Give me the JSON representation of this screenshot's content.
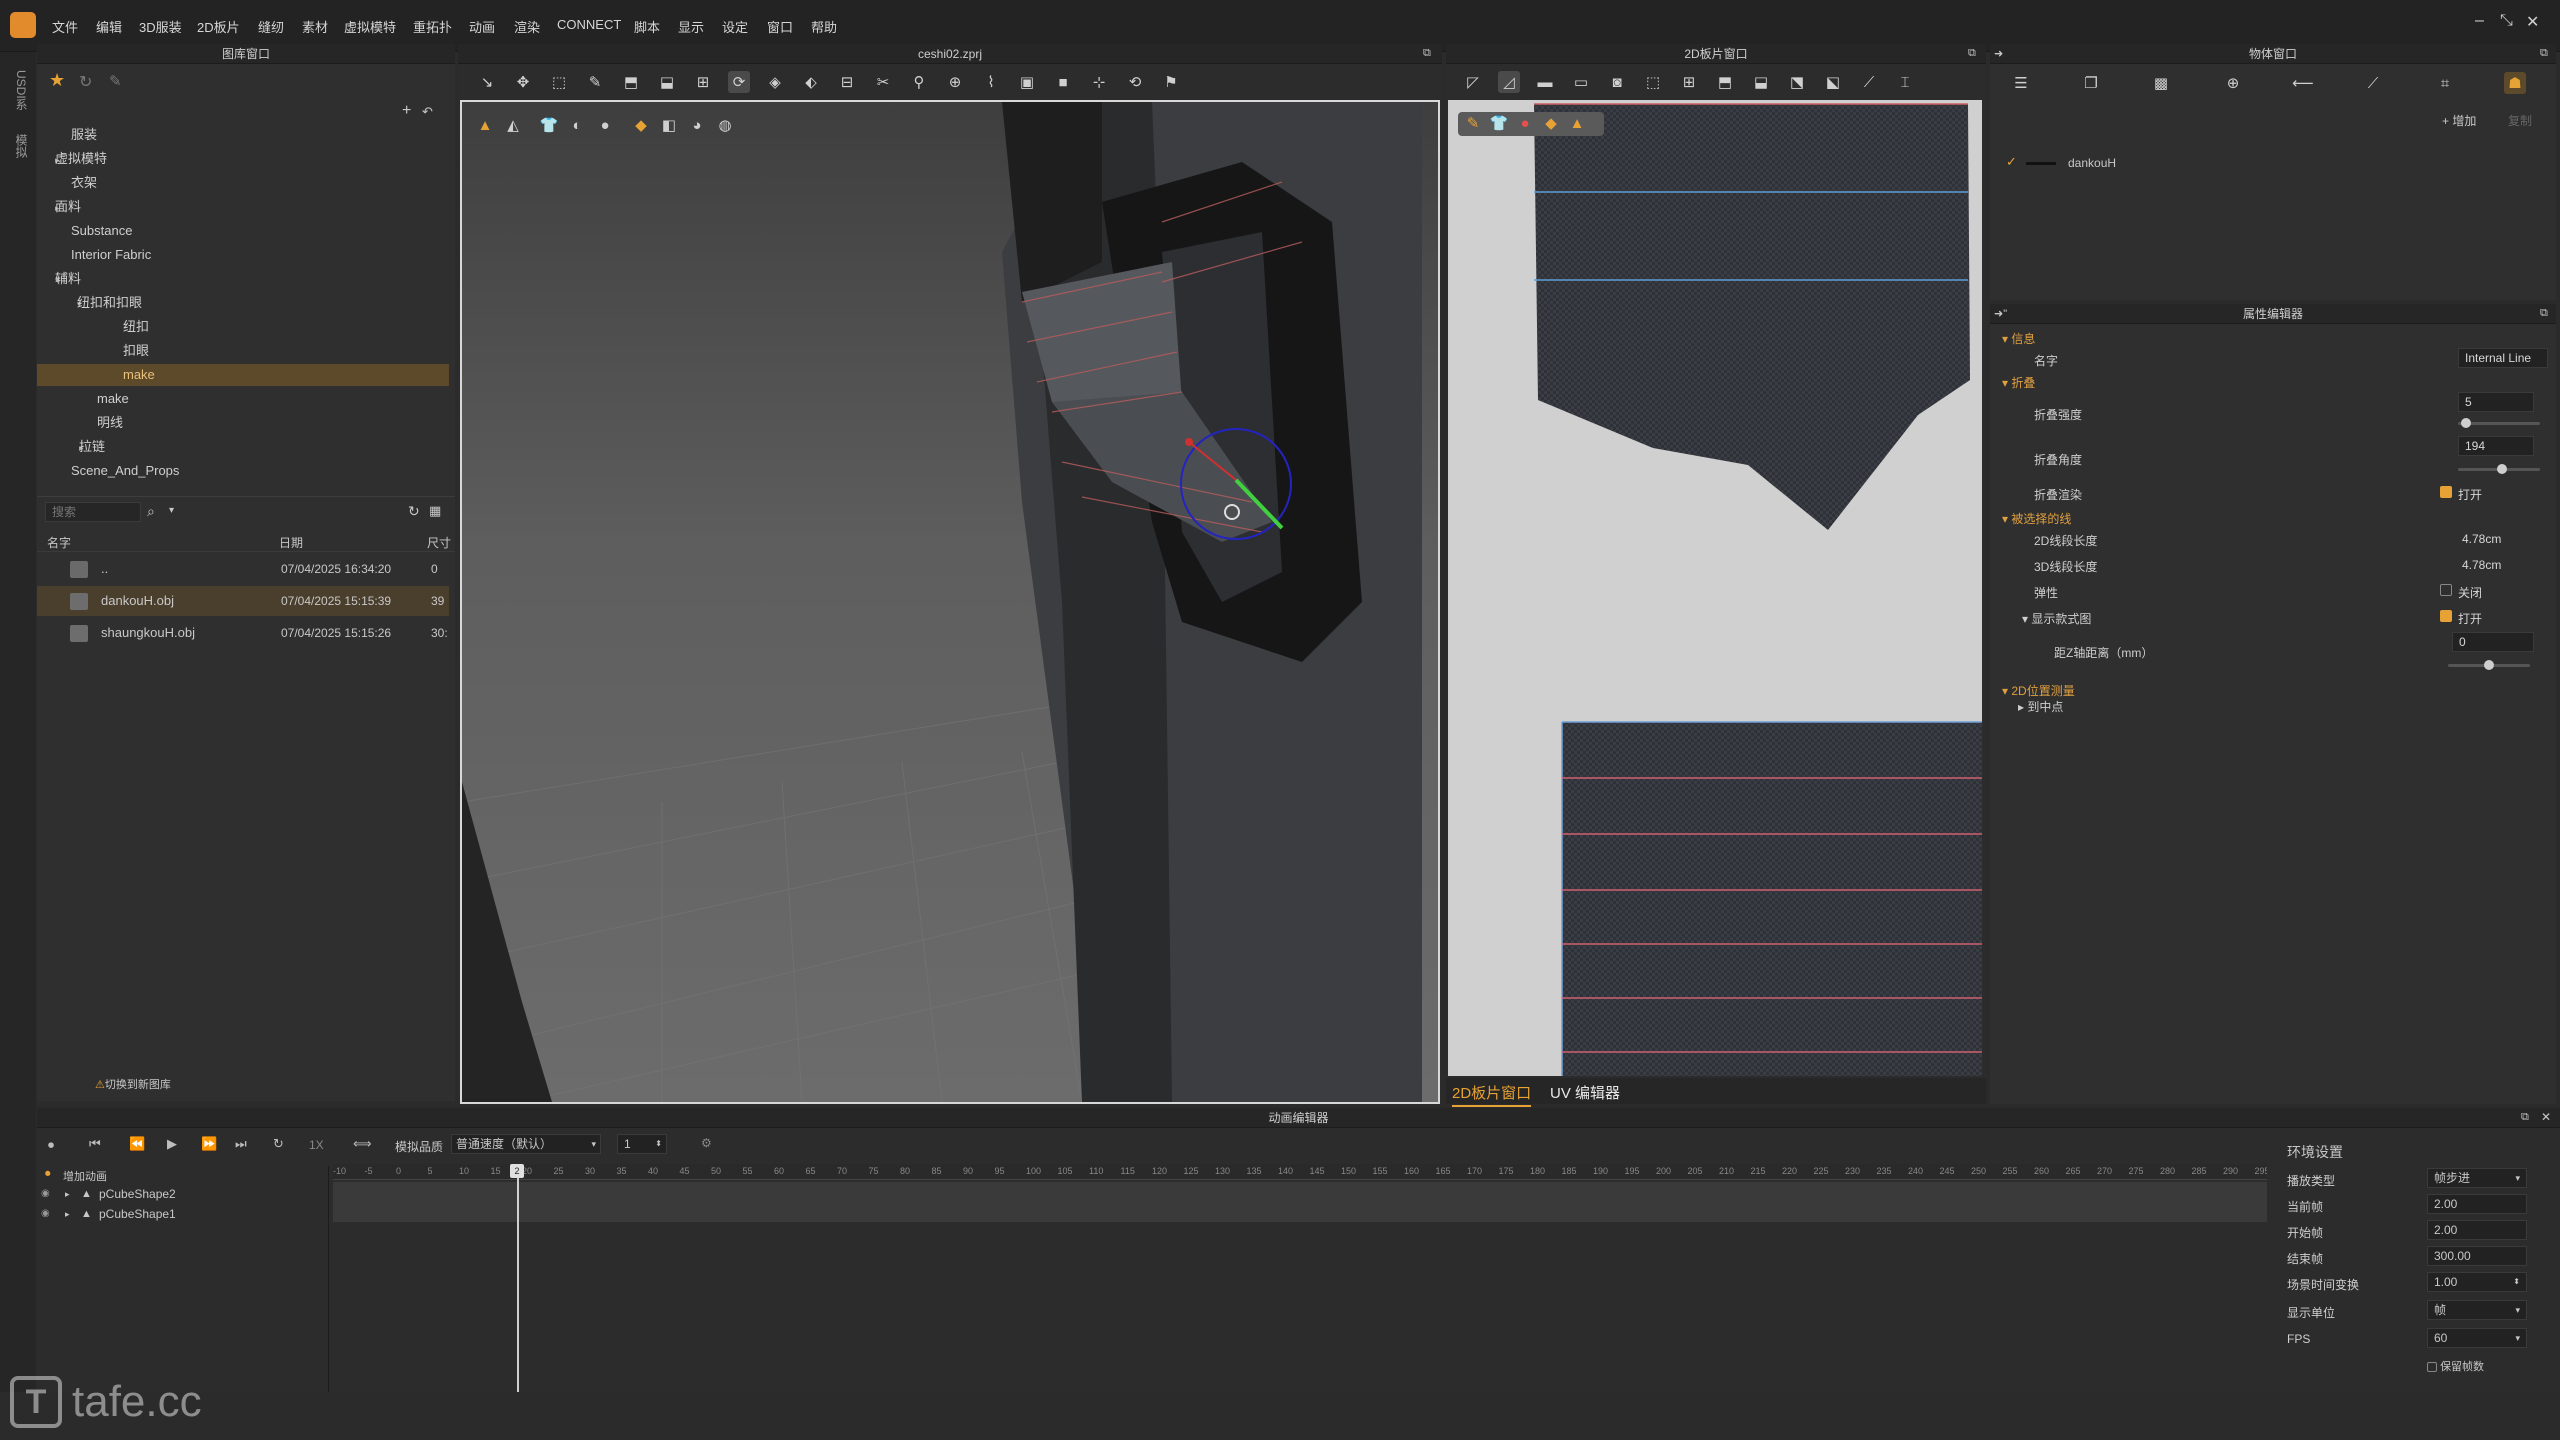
{
  "menubar": {
    "items": [
      "文件",
      "编辑",
      "3D服装",
      "2D板片",
      "缝纫",
      "素材",
      "虚拟模特",
      "重拓扑",
      "动画",
      "渲染",
      "CONNECT",
      "脚本",
      "显示",
      "设定",
      "窗口",
      "帮助"
    ]
  },
  "side_tabs": [
    "USDI系",
    "模拟"
  ],
  "library": {
    "title": "图库窗口",
    "tree": [
      {
        "label": "服装",
        "indent": 0,
        "arrow": ""
      },
      {
        "label": "虚拟模特",
        "indent": 0,
        "arrow": "▸"
      },
      {
        "label": "衣架",
        "indent": 0,
        "arrow": ""
      },
      {
        "label": "面料",
        "indent": 0,
        "arrow": "▸"
      },
      {
        "label": "Substance",
        "indent": 0,
        "arrow": ""
      },
      {
        "label": "Interior Fabric",
        "indent": 0,
        "arrow": ""
      },
      {
        "label": "辅料",
        "indent": 0,
        "arrow": "▾"
      },
      {
        "label": "纽扣和扣眼",
        "indent": 1,
        "arrow": "▾"
      },
      {
        "label": "纽扣",
        "indent": 2,
        "arrow": ""
      },
      {
        "label": "扣眼",
        "indent": 2,
        "arrow": ""
      },
      {
        "label": "make",
        "indent": 2,
        "arrow": "",
        "selected": true
      },
      {
        "label": "make",
        "indent": 1,
        "arrow": ""
      },
      {
        "label": "明线",
        "indent": 1,
        "arrow": ""
      },
      {
        "label": "拉链",
        "indent": 1,
        "arrow": "▸"
      },
      {
        "label": "Scene_And_Props",
        "indent": 0,
        "arrow": ""
      }
    ],
    "search_placeholder": "搜索",
    "columns": {
      "name": "名字",
      "date": "日期",
      "size": "尺寸"
    },
    "files": [
      {
        "name": "..",
        "date": "07/04/2025 16:34:20",
        "size": "0",
        "folder": true
      },
      {
        "name": "dankouH.obj",
        "date": "07/04/2025 15:15:39",
        "size": "39",
        "selected": true
      },
      {
        "name": "shaungkouH.obj",
        "date": "07/04/2025 15:15:26",
        "size": "30:"
      }
    ],
    "footer_link": "切换到新图库"
  },
  "viewport3d": {
    "title": "ceshi02.zprj"
  },
  "viewport2d": {
    "title": "2D板片窗口",
    "tabs": [
      "2D板片窗口",
      "UV 编辑器"
    ]
  },
  "object_window": {
    "title": "物体窗口",
    "add_label": "+ 增加",
    "copy_label": "复制",
    "items": [
      {
        "name": "dankouH",
        "checked": true
      }
    ]
  },
  "property_editor": {
    "title": "属性编辑器",
    "section_info": "信息",
    "name_label": "名字",
    "name_value": "Internal Line",
    "section_fold": "折叠",
    "fold_strength_label": "折叠强度",
    "fold_strength_value": "5",
    "fold_strength_fraction": 0.1,
    "fold_angle_label": "折叠角度",
    "fold_angle_value": "194",
    "fold_angle_fraction": 0.54,
    "fold_render_label": "折叠渲染",
    "fold_render_value": "打开",
    "section_selected_line": "被选择的线",
    "len2d_label": "2D线段长度",
    "len2d_value": "4.78cm",
    "len3d_label": "3D线段长度",
    "len3d_value": "4.78cm",
    "elastic_label": "弹性",
    "elastic_value": "关闭",
    "show_style_label": "显示款式图",
    "show_style_value": "打开",
    "z_offset_label": "距Z轴距离（mm）",
    "z_offset_value": "0",
    "z_offset_fraction": 0.5,
    "section_2d_measure": "2D位置测量",
    "to_midpoint": "到中点"
  },
  "anim_editor": {
    "title": "动画编辑器",
    "sim_quality_label": "模拟品质",
    "speed_value": "普通速度（默认）",
    "step_value": "1",
    "speed_x": "1X",
    "add_anim": "增加动画",
    "tracks": [
      "pCubeShape2",
      "pCubeShape1"
    ],
    "current_frame_marker": "2",
    "ruler_labels": [
      "-10",
      "-5",
      "0",
      "5",
      "10",
      "15",
      "20",
      "25",
      "30",
      "35",
      "40",
      "45",
      "50",
      "55",
      "60",
      "65",
      "70",
      "75",
      "80",
      "85",
      "90",
      "95",
      "100",
      "105",
      "110",
      "115",
      "120",
      "125",
      "130",
      "135",
      "140",
      "145",
      "150",
      "155",
      "160",
      "165",
      "170",
      "175",
      "180",
      "185",
      "190",
      "195",
      "200",
      "205",
      "210",
      "215",
      "220",
      "225",
      "230",
      "235",
      "240",
      "245",
      "250",
      "255",
      "260",
      "265",
      "270",
      "275",
      "280",
      "285",
      "290",
      "295"
    ]
  },
  "env_settings": {
    "title": "环境设置",
    "rows": [
      {
        "label": "播放类型",
        "value": "帧步进",
        "dropdown": true
      },
      {
        "label": "当前帧",
        "value": "2.00"
      },
      {
        "label": "开始帧",
        "value": "2.00"
      },
      {
        "label": "结束帧",
        "value": "300.00"
      },
      {
        "label": "场景时间变换",
        "value": "1.00",
        "spinner": true
      },
      {
        "label": "显示单位",
        "value": "帧",
        "dropdown": true
      },
      {
        "label": "FPS",
        "value": "60",
        "dropdown": true
      }
    ],
    "keep_frames_label": "保留帧数"
  },
  "watermark": "tafe.cc",
  "colors": {
    "accent": "#e7a235",
    "selection": "#5d4a2b",
    "bg": "#2f2f2f",
    "viewport": "#5a5a5a",
    "pattern_bg": "#d0d0d0"
  }
}
